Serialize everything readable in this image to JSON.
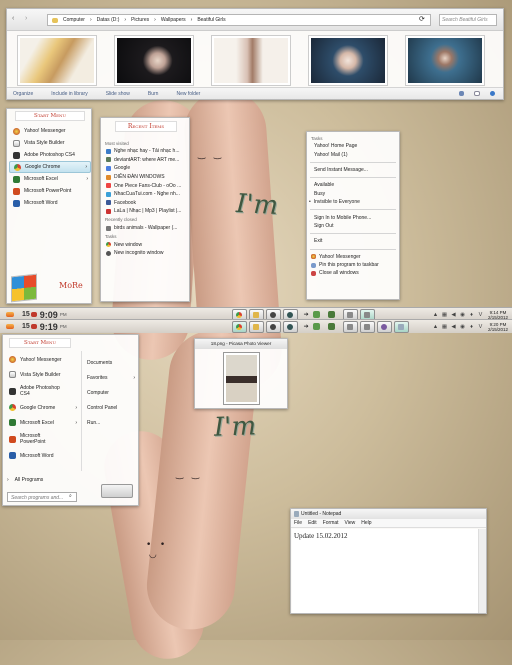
{
  "explorer": {
    "breadcrumb": [
      "Computer",
      "Datas (D:)",
      "Pictures",
      "Wallpapers",
      "Beatiful Girls"
    ],
    "search_placeholder": "Search Beatiful Girls",
    "toolbar": [
      "Organize",
      "Include in library",
      "Slide show",
      "Burn",
      "New folder"
    ]
  },
  "start_menu_top": {
    "header": "Start Menu",
    "items": [
      "Yahoo! Messenger",
      "Vista Style Builder",
      "Adobe Photoshop CS4",
      "Google Chrome",
      "Microsoft Excel",
      "Microsoft PowerPoint",
      "Microsoft Word"
    ],
    "more_label": "MoRe"
  },
  "recent_items": {
    "header": "Recent Items",
    "most_visited_label": "Most visited",
    "most_visited": [
      "Nghe nhạc hay - Tải nhạc h...",
      "deviantART: where ART me...",
      "Google",
      "DIỄN ĐÀN WINDOWS",
      "One Piece Fans-Club - oOo ...",
      "NhacCuaTui.com - Nghe nh...",
      "Facebook",
      "LaLa | Nhạc | Mp3 | Playlist |..."
    ],
    "recently_closed_label": "Recently closed",
    "recently_closed": [
      "birds animals - Wallpaper (..."
    ],
    "tasks_label": "Tasks",
    "tasks": [
      "New window",
      "New incognito window"
    ]
  },
  "jump_list": {
    "tasks_label": "Tasks",
    "items1": [
      "Yahoo! Home Page",
      "Yahoo! Mail (1)"
    ],
    "items2": [
      "Send Instant Message..."
    ],
    "items3": [
      "Available",
      "Busy",
      "Invisible to Everyone"
    ],
    "items4": [
      "Sign In to Mobile Phone...",
      "Sign Out"
    ],
    "items5": [
      "Exit"
    ],
    "items6": [
      "Yahoo! Messenger",
      "Pin this program to taskbar",
      "Close all windows"
    ]
  },
  "taskbar_top": {
    "date_prefix": "15",
    "time": "9:09",
    "ampm": "PM",
    "clock_time": "9:14 PM",
    "clock_date": "2/15/2012"
  },
  "taskbar_bottom": {
    "date_prefix": "15",
    "time": "9:19",
    "ampm": "PM",
    "clock_time": "9:20 PM",
    "clock_date": "2/15/2012"
  },
  "start_menu_bottom": {
    "header": "Start Menu",
    "items": [
      "Yahoo! Messenger",
      "Vista Style Builder",
      "Adobe Photoshop CS4",
      "Google Chrome",
      "Microsoft Excel",
      "Microsoft PowerPoint",
      "Microsoft Word"
    ],
    "right_items": [
      "Documents",
      "Favorites",
      "Computer",
      "Control Panel",
      "Run..."
    ],
    "all_programs": "All Programs",
    "search_placeholder": "Search programs and..."
  },
  "picasa": {
    "title": "18.png - Picasa Photo Viewer"
  },
  "notepad": {
    "title": "Untitled - Notepad",
    "menu": [
      "File",
      "Edit",
      "Format",
      "View",
      "Help"
    ],
    "content": "Update 15.02.2012"
  },
  "colors": {
    "accent": "#c0392b",
    "taskbar": "#d8d3cb",
    "desktop": "#cdbd9c"
  }
}
